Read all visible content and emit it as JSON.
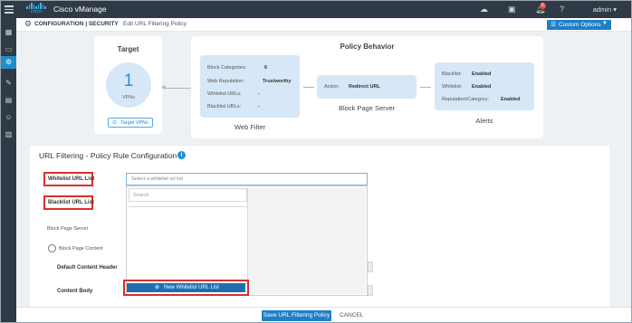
{
  "app": {
    "logo_text": "cisco",
    "title": "Cisco vManage"
  },
  "topbar": {
    "notification_count": "5",
    "user": "admin"
  },
  "leftnav": [
    {
      "icon": "dashboard-icon"
    },
    {
      "icon": "monitor-icon"
    },
    {
      "icon": "configuration-gear-icon",
      "active": true
    },
    {
      "icon": "tools-wrench-icon"
    },
    {
      "icon": "maintenance-briefcase-icon"
    },
    {
      "icon": "administration-users-icon"
    },
    {
      "icon": "analytics-icon"
    }
  ],
  "breadcrumb": {
    "main": "CONFIGURATION | SECURITY",
    "sub": "Edit URL Filtering Policy"
  },
  "custom_options": {
    "label": "Custom Options"
  },
  "target": {
    "title": "Target",
    "count": "1",
    "unit": "VPNs",
    "button": "Target VPNs"
  },
  "policy_behavior": {
    "title": "Policy Behavior",
    "web_filter": {
      "caption": "Web Filter",
      "rows": [
        {
          "key": "Block Categories:",
          "value": "6"
        },
        {
          "key": "Web Reputation:",
          "value": "Trustworthy"
        },
        {
          "key": "Whitelist URLs:",
          "value": "-"
        },
        {
          "key": "Blacklist URLs:",
          "value": "-"
        }
      ]
    },
    "block_page": {
      "caption": "Block Page Server",
      "key": "Action:",
      "value": "Redirect URL"
    },
    "alerts": {
      "caption": "Alerts",
      "rows": [
        {
          "key": "Blacklist:",
          "value": "Enabled"
        },
        {
          "key": "Whitelist:",
          "value": "Enabled"
        },
        {
          "key": "Reputation/Category:",
          "value": "Enabled"
        }
      ]
    }
  },
  "rule_config": {
    "title": "URL Filtering - Policy Rule Configuration",
    "whitelist_label": "Whitelist URL List",
    "whitelist_placeholder": "Select a whitelist url list",
    "search_placeholder": "Search",
    "blacklist_label": "Blacklist URL List",
    "block_page_server_label": "Block Page Server",
    "block_page_content_label": "Block Page Content",
    "default_content_header_label": "Default Content Header",
    "content_body_label": "Content Body",
    "new_whitelist_button": "New Whitelist URL List"
  },
  "footer": {
    "save": "Save URL Filtering Policy",
    "cancel": "CANCEL"
  },
  "colors": {
    "topbar": "#2f3a46",
    "accent": "#1e7fc7",
    "highlight": "#d9302a",
    "card_fill": "#d6e7f7"
  }
}
